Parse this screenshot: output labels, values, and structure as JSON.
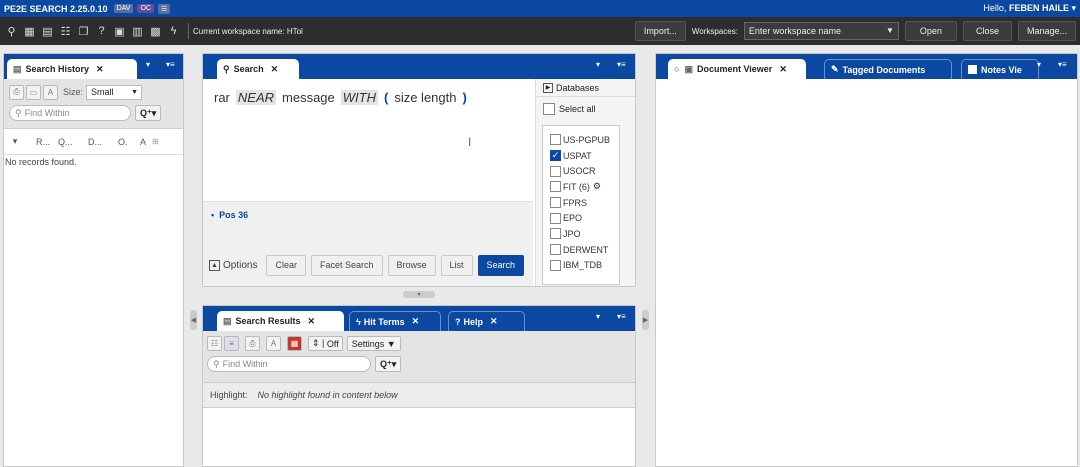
{
  "app": {
    "title": "PE2E SEARCH 2.25.0.10",
    "chips": [
      "DAV",
      "OC"
    ],
    "greeting": "Hello,",
    "user": "FEBEN HAILE"
  },
  "toolbar": {
    "workspace_name": "Current workspace name: HTol",
    "import_label": "Import...",
    "workspaces_label": "Workspaces:",
    "workspace_placeholder": "Enter workspace name",
    "open_label": "Open",
    "close_label": "Close",
    "manage_label": "Manage..."
  },
  "history": {
    "tab": "Search History",
    "size_label": "Size:",
    "size_value": "Small",
    "find_placeholder": "Find Within",
    "columns": [
      "R...",
      "Q...",
      "D...",
      "O.",
      "A"
    ],
    "empty": "No records found."
  },
  "search": {
    "tab": "Search",
    "query": [
      {
        "t": "rar",
        "k": "word"
      },
      {
        "t": "NEAR",
        "k": "op"
      },
      {
        "t": "message",
        "k": "word"
      },
      {
        "t": "WITH",
        "k": "op"
      },
      {
        "t": "(",
        "k": "paren"
      },
      {
        "t": "size length",
        "k": "word"
      },
      {
        "t": ")",
        "k": "paren"
      }
    ],
    "pos": "Pos 36",
    "options_label": "Options",
    "buttons": [
      "Clear",
      "Facet Search",
      "Browse",
      "List",
      "Search"
    ],
    "databases_label": "Databases",
    "select_all": "Select all",
    "databases": [
      {
        "name": "US-PGPUB",
        "checked": false
      },
      {
        "name": "USPAT",
        "checked": true
      },
      {
        "name": "USOCR",
        "checked": false
      },
      {
        "name": "FIT (6)",
        "checked": false,
        "gear": true
      },
      {
        "name": "FPRS",
        "checked": false
      },
      {
        "name": "EPO",
        "checked": false
      },
      {
        "name": "JPO",
        "checked": false
      },
      {
        "name": "DERWENT",
        "checked": false
      },
      {
        "name": "IBM_TDB",
        "checked": false
      }
    ]
  },
  "results": {
    "tabs": [
      "Search Results",
      "Hit Terms",
      "Help"
    ],
    "off_label": "Off",
    "settings_label": "Settings",
    "find_placeholder": "Find Within",
    "highlight_label": "Highlight:",
    "highlight_value": "No highlight found in content below"
  },
  "viewer": {
    "tabs": [
      "Document Viewer",
      "Tagged Documents",
      "Notes Vie"
    ]
  }
}
